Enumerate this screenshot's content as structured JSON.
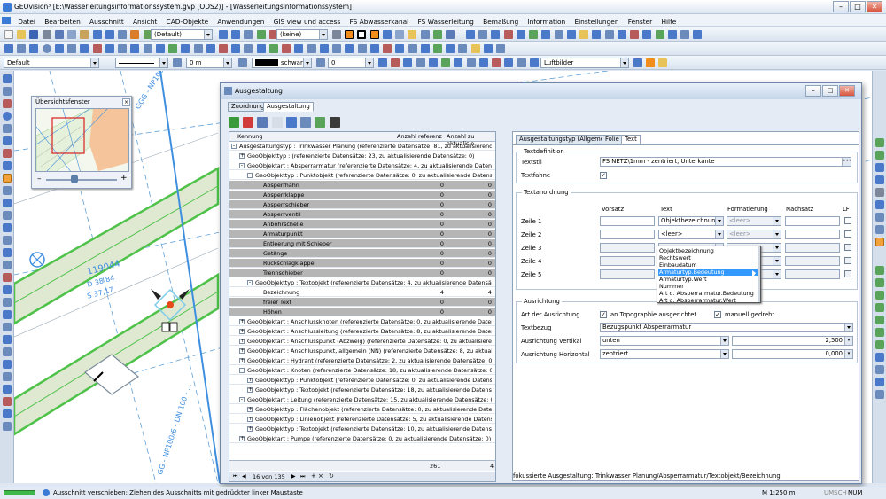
{
  "window": {
    "title": "GEOvision³ [E:\\Wasserleitungsinformationssystem.gvp (ODS2)] - [Wasserleitungsinformationssystem]",
    "minimize": "–",
    "maximize": "□",
    "close": "✕"
  },
  "menu": [
    "Datei",
    "Bearbeiten",
    "Ausschnitt",
    "Ansicht",
    "CAD-Objekte",
    "Anwendungen",
    "GIS view und access",
    "FS Abwasserkanal",
    "FS Wasserleitung",
    "Bemaßung",
    "Information",
    "Einstellungen",
    "Fenster",
    "Hilfe"
  ],
  "toolbar1": {
    "style_combo": "(Default)",
    "filter_combo": "(keine)"
  },
  "toolbar3": {
    "layer_combo": "Default",
    "offset_value": "0 m",
    "color_label": "schwarz",
    "number_value": "0",
    "imagery_combo": "Luftbilder"
  },
  "overview": {
    "title": "Übersichtsfenster",
    "zoom_minus": "–",
    "zoom_plus": "+"
  },
  "map_labels": {
    "pipe1": "GGG - NP100/6 - DN 200-N2",
    "lbl_val": "119044",
    "lbl_d": "D 38,84",
    "lbl_s": "S 37,17",
    "pipe2": "GG - NP100/6 - DN 100 - ..."
  },
  "dialog": {
    "title": "Ausgestaltung",
    "tabs": [
      {
        "label": "Zuordnung",
        "active": false
      },
      {
        "label": "Ausgestaltung",
        "active": true
      }
    ],
    "tree_headers": [
      "Kennung",
      "Anzahl referenz",
      "Anzahl zu aktualisie"
    ],
    "tree_rows": [
      {
        "level": 0,
        "sign": "-",
        "text": "Ausgestaltungstyp : Trinkwasser Planung (referenzierte Datensätze: 81, zu aktualisierende Datens...",
        "a": "",
        "b": ""
      },
      {
        "level": 1,
        "sign": "+",
        "text": "GeoObjekttyp :  (referenzierte Datensätze: 23, zu aktualisierende Datensätze: 0)",
        "a": "",
        "b": ""
      },
      {
        "level": 1,
        "sign": "-",
        "text": "GeoObjektart : Absperrarmatur (referenzierte Datensätze: 4, zu aktualisierende Datensä...",
        "a": "",
        "b": ""
      },
      {
        "level": 2,
        "sign": "-",
        "text": "GeoObjekttyp : Punktobjekt (referenzierte Datensätze: 0, zu aktualisierende Datensä...",
        "a": "",
        "b": ""
      },
      {
        "level": 3,
        "sign": "",
        "text": "Absperrhahn",
        "a": "0",
        "b": "0",
        "gray": true
      },
      {
        "level": 3,
        "sign": "",
        "text": "Absperrklappe",
        "a": "0",
        "b": "0",
        "gray": true
      },
      {
        "level": 3,
        "sign": "",
        "text": "Absperrschieber",
        "a": "0",
        "b": "0",
        "gray": true
      },
      {
        "level": 3,
        "sign": "",
        "text": "Absperrventil",
        "a": "0",
        "b": "0",
        "gray": true
      },
      {
        "level": 3,
        "sign": "",
        "text": "Anbohrschelle",
        "a": "0",
        "b": "0",
        "gray": true
      },
      {
        "level": 3,
        "sign": "",
        "text": "Armaturpunkt",
        "a": "0",
        "b": "0",
        "gray": true
      },
      {
        "level": 3,
        "sign": "",
        "text": "Entleerung mit Schieber",
        "a": "0",
        "b": "0",
        "gray": true
      },
      {
        "level": 3,
        "sign": "",
        "text": "Getänge",
        "a": "0",
        "b": "0",
        "gray": true
      },
      {
        "level": 3,
        "sign": "",
        "text": "Rückschlagklappe",
        "a": "0",
        "b": "0",
        "gray": true
      },
      {
        "level": 3,
        "sign": "",
        "text": "Trennschieber",
        "a": "0",
        "b": "0",
        "gray": true
      },
      {
        "level": 2,
        "sign": "-",
        "text": "GeoObjekttyp : Textobjekt (referenzierte Datensätze: 4, zu aktualisierende Datensä...",
        "a": "",
        "b": ""
      },
      {
        "level": 3,
        "sign": "",
        "text": "Bezeichnung",
        "a": "4",
        "b": "4",
        "sel": true
      },
      {
        "level": 3,
        "sign": "",
        "text": "freier Text",
        "a": "0",
        "b": "0",
        "gray": true
      },
      {
        "level": 3,
        "sign": "",
        "text": "Höhen",
        "a": "0",
        "b": "0",
        "gray": true
      },
      {
        "level": 1,
        "sign": "+",
        "text": "GeoObjektart : Anschlussknoten (referenzierte Datensätze: 0, zu aktualisierende Datens...",
        "a": "",
        "b": ""
      },
      {
        "level": 1,
        "sign": "+",
        "text": "GeoObjektart : Anschlussleitung (referenzierte Datensätze: 8, zu aktualisierende Datens...",
        "a": "",
        "b": ""
      },
      {
        "level": 1,
        "sign": "+",
        "text": "GeoObjektart : Anschlusspunkt (Abzweig) (referenzierte Datensätze: 0, zu aktualisierende...",
        "a": "",
        "b": ""
      },
      {
        "level": 1,
        "sign": "+",
        "text": "GeoObjektart : Anschlusspunkt, allgemein (NN) (referenzierte Datensätze: 8, zu aktualisie...",
        "a": "",
        "b": ""
      },
      {
        "level": 1,
        "sign": "+",
        "text": "GeoObjektart : Hydrant (referenzierte Datensätze: 2, zu aktualisierende Datensätze: 0)",
        "a": "",
        "b": ""
      },
      {
        "level": 1,
        "sign": "-",
        "text": "GeoObjektart : Knoten (referenzierte Datensätze: 18, zu aktualisierende Datensätze: 0)",
        "a": "",
        "b": ""
      },
      {
        "level": 2,
        "sign": "+",
        "text": "GeoObjekttyp : Punktobjekt (referenzierte Datensätze: 0, zu aktualisierende Datensä...",
        "a": "",
        "b": ""
      },
      {
        "level": 2,
        "sign": "+",
        "text": "GeoObjekttyp : Textobjekt (referenzierte Datensätze: 18, zu aktualisierende Datens...",
        "a": "",
        "b": ""
      },
      {
        "level": 1,
        "sign": "-",
        "text": "GeoObjektart : Leitung (referenzierte Datensätze: 15, zu aktualisierende Datensätze: 0)",
        "a": "",
        "b": ""
      },
      {
        "level": 2,
        "sign": "+",
        "text": "GeoObjekttyp : Flächenobjekt (referenzierte Datensätze: 0, zu aktualisierende Datense...",
        "a": "",
        "b": ""
      },
      {
        "level": 2,
        "sign": "+",
        "text": "GeoObjekttyp : Linienobjekt (referenzierte Datensätze: 5, zu aktualisierende Datensä...",
        "a": "",
        "b": ""
      },
      {
        "level": 2,
        "sign": "+",
        "text": "GeoObjekttyp : Textobjekt (referenzierte Datensätze: 10, zu aktualisierende Datensä...",
        "a": "",
        "b": ""
      },
      {
        "level": 1,
        "sign": "+",
        "text": "GeoObjektart : Pumpe (referenzierte Datensätze: 0, zu aktualisierende Datensätze: 0)",
        "a": "",
        "b": ""
      }
    ],
    "tree_footer": {
      "nav": "16 von 135",
      "total1": "261",
      "total2": "4"
    },
    "right_tabs": [
      {
        "label": "Ausgestaltungstyp (Allgemein)",
        "active": false
      },
      {
        "label": "Folie",
        "active": false
      },
      {
        "label": "Text",
        "active": true
      }
    ],
    "textdef": {
      "group": "Textdefinition",
      "textstil_label": "Textstil",
      "textstil_value": "FS NETZ\\1mm - zentriert, Unterkante",
      "textfahne_label": "Textfahne",
      "textfahne_checked": "✓"
    },
    "textanordnung": {
      "group": "Textanordnung",
      "headers": [
        "Vorsatz",
        "Text",
        "Formatierung",
        "Nachsatz",
        "LF"
      ],
      "rows": [
        {
          "label": "Zeile 1",
          "text": "Objektbezeichnung",
          "format": "<leer>"
        },
        {
          "label": "Zeile 2",
          "text": "<leer>",
          "format": "<leer>"
        },
        {
          "label": "Zeile 3",
          "text": "",
          "format": ""
        },
        {
          "label": "Zeile 4",
          "text": "",
          "format": ""
        },
        {
          "label": "Zeile 5",
          "text": "",
          "format": ""
        }
      ],
      "dropdown_options": [
        "Objektbezeichnung",
        "Rechtswert",
        "Einbaudatum",
        "Armaturtyp.Bedeutung",
        "Armaturtyp.Wert",
        "Nummer",
        "Art d. Absperrarmatur.Bedeutung",
        "Art d. Absperrarmatur.Wert"
      ],
      "dropdown_selected": 3
    },
    "ausrichtung": {
      "group": "Ausrichtung",
      "art_label": "Art der Ausrichtung",
      "topo_label": "an Topographie ausgerichtet",
      "topo_checked": "✓",
      "gedreht_label": "manuell gedreht",
      "gedreht_checked": "✓",
      "textbezug_label": "Textbezug",
      "textbezug_value": "Bezugspunkt Absperrarmatur",
      "vert_label": "Ausrichtung Vertikal",
      "vert_value": "unten",
      "vert_num": "2,500",
      "horz_label": "Ausrichtung Horizontal",
      "horz_value": "zentriert",
      "horz_num": "0,000"
    },
    "focus_status": "fokussierte Ausgestaltung: Trinkwasser Planung/Absperrarmatur/Textobjekt/Bezeichnung"
  },
  "status": {
    "hint": "Ausschnitt verschieben: Ziehen des Ausschnitts mit gedrückter linker Maustaste",
    "scale": "M 1:250 m",
    "flags": [
      "UMSCH",
      "NUM"
    ]
  },
  "colors": {
    "accent": "#3399ff",
    "pipe_green": "#4fc24a",
    "pipe_fill": "#dfe9d2",
    "titlebar": "#c6d6ea"
  }
}
